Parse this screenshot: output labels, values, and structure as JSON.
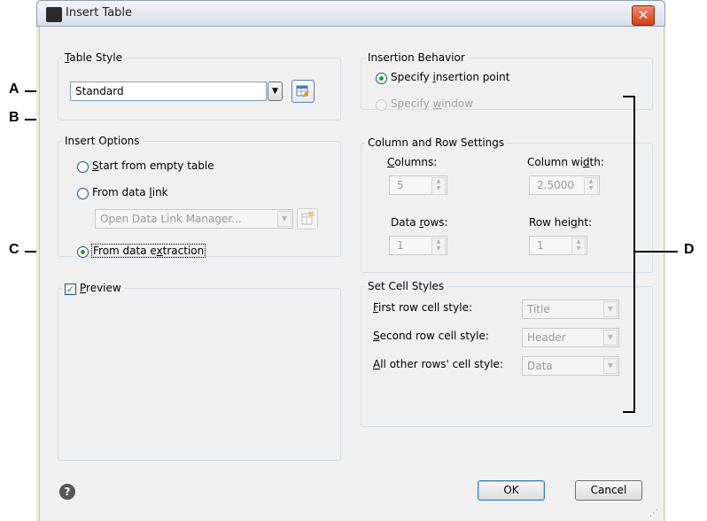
{
  "window": {
    "title": "Insert Table",
    "close_symbol": "✕"
  },
  "table_style": {
    "legend": "Table Style",
    "legend_accesskey": "T",
    "legend_rest": "able Style",
    "selected": "Standard"
  },
  "insert_options": {
    "legend": "Insert Options",
    "options": [
      {
        "prefix": "",
        "key": "S",
        "rest": "tart from empty table",
        "selected": false
      },
      {
        "prefix": "From data ",
        "key": "l",
        "rest": "ink",
        "selected": false
      },
      {
        "prefix": "From data e",
        "key": "x",
        "rest": "traction",
        "selected": true
      }
    ],
    "data_link_combo": "Open Data Link Manager..."
  },
  "preview": {
    "label_key": "P",
    "label_rest": "review",
    "checked": true
  },
  "insertion_behavior": {
    "legend": "Insertion Behavior",
    "option1": {
      "prefix": "Specify ",
      "key": "i",
      "rest": "nsertion point"
    },
    "option2": {
      "prefix": "Specify ",
      "key": "w",
      "rest": "indow"
    }
  },
  "column_row": {
    "legend": "Column and Row Settings",
    "columns": {
      "key": "C",
      "rest": "olumns:",
      "value": "5"
    },
    "column_width": {
      "prefix": "Column wi",
      "key": "d",
      "rest": "th:",
      "value": "2.5000"
    },
    "data_rows": {
      "prefix": "Data ",
      "key": "r",
      "rest": "ows:",
      "value": "1"
    },
    "row_height": {
      "prefix": "Row hei",
      "key": "g",
      "rest": "ht:",
      "value": "1"
    }
  },
  "cell_styles": {
    "legend": "Set Cell Styles",
    "first": {
      "key": "F",
      "rest": "irst row cell style:",
      "value": "Title"
    },
    "second": {
      "key": "S",
      "rest": "econd row cell style:",
      "value": "Header"
    },
    "other": {
      "key": "A",
      "rest": "ll other rows' cell style:",
      "value": "Data"
    }
  },
  "buttons": {
    "ok": "OK",
    "cancel": "Cancel",
    "help_symbol": "?"
  },
  "callouts": {
    "a": "A",
    "b": "B",
    "c": "C",
    "d": "D"
  }
}
